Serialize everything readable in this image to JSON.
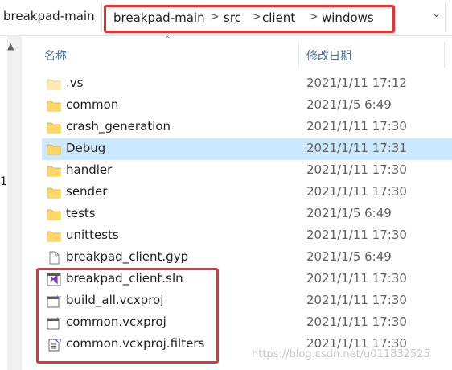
{
  "window": {
    "title": "breakpad-main"
  },
  "address_bar": {
    "crumbs": [
      "breakpad-main",
      "src",
      "client",
      "windows"
    ],
    "separator": ">",
    "dropdown_icon": "chevron-down-icon",
    "highlight_color": "#e53333"
  },
  "columns": {
    "name": "名称",
    "date_modified": "修改日期"
  },
  "left_pane": {
    "marker": "1"
  },
  "files": [
    {
      "name": ".vs",
      "date": "2021/1/11 17:12",
      "icon": "folder-icon-light"
    },
    {
      "name": "common",
      "date": "2021/1/5 6:49",
      "icon": "folder-icon"
    },
    {
      "name": "crash_generation",
      "date": "2021/1/11 17:30",
      "icon": "folder-icon"
    },
    {
      "name": "Debug",
      "date": "2021/1/11 17:31",
      "icon": "folder-icon",
      "selected": true
    },
    {
      "name": "handler",
      "date": "2021/1/11 17:30",
      "icon": "folder-icon"
    },
    {
      "name": "sender",
      "date": "2021/1/11 17:30",
      "icon": "folder-icon"
    },
    {
      "name": "tests",
      "date": "2021/1/5 6:49",
      "icon": "folder-icon"
    },
    {
      "name": "unittests",
      "date": "2021/1/11 17:30",
      "icon": "folder-icon"
    },
    {
      "name": "breakpad_client.gyp",
      "date": "2021/1/5 6:49",
      "icon": "file-icon"
    },
    {
      "name": "breakpad_client.sln",
      "date": "2021/1/11 17:30",
      "icon": "visual-studio-solution-icon"
    },
    {
      "name": "build_all.vcxproj",
      "date": "2021/1/11 17:30",
      "icon": "vcxproj-icon"
    },
    {
      "name": "common.vcxproj",
      "date": "2021/1/11 17:30",
      "icon": "vcxproj-icon"
    },
    {
      "name": "common.vcxproj.filters",
      "date": "2021/1/11 17:30",
      "icon": "filters-file-icon"
    }
  ],
  "watermark": "https://blog.csdn.net/u011832525",
  "colors": {
    "selection": "#cce8ff",
    "folder": "#f8d775",
    "header_text": "#4c6f98"
  }
}
